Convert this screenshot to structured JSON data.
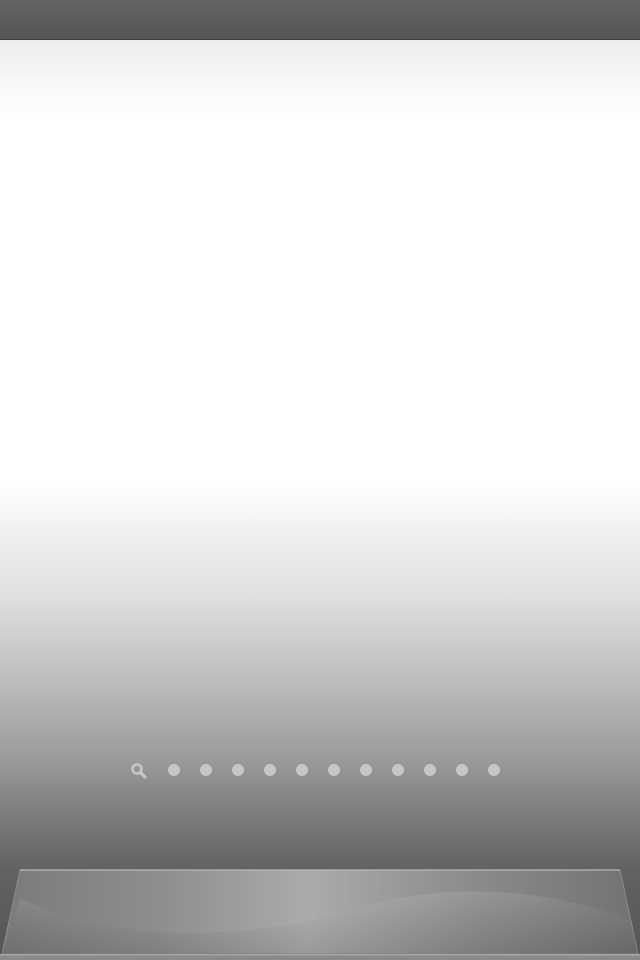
{
  "status_bar": {
    "color": "#5a5a5a"
  },
  "page_indicator": {
    "search_icon": "search-icon",
    "page_count": 11,
    "current_page": 0,
    "dot_color": "#c6c6c6"
  },
  "dock": {
    "icon_count": 0
  }
}
